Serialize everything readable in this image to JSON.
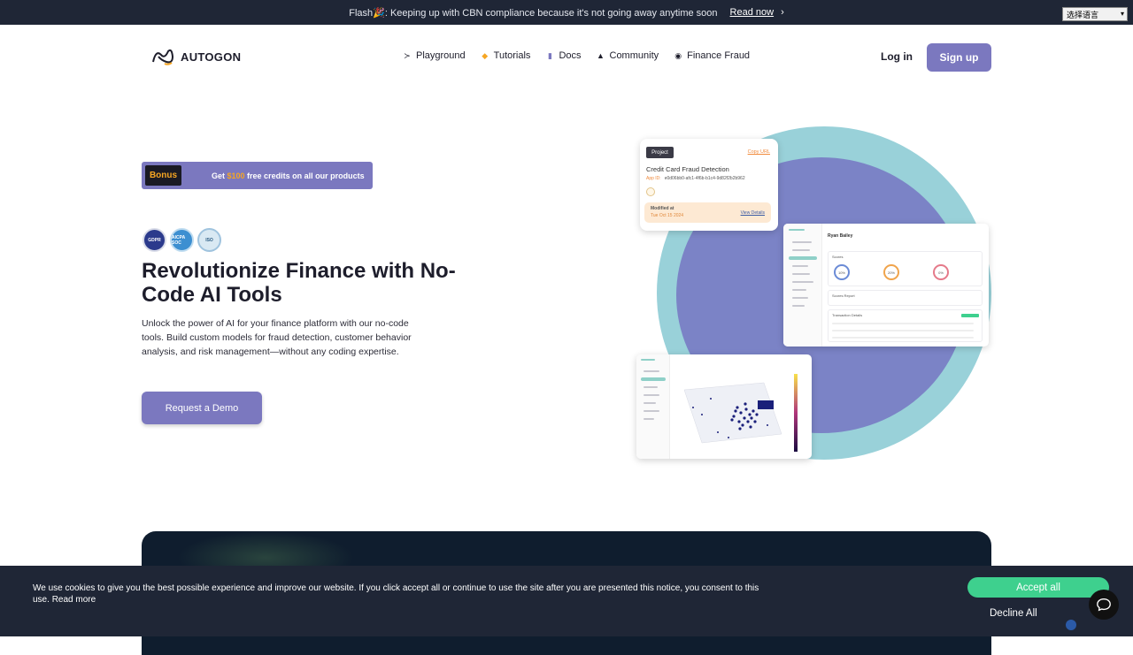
{
  "flash": {
    "message": "Flash🎉: Keeping up with CBN compliance because it's not going away anytime soon",
    "read_now": "Read now",
    "chevron": "›"
  },
  "language_select": {
    "value": "选择语言",
    "arrow": "▾"
  },
  "header": {
    "logo_text": "AUTOGON",
    "nav": [
      {
        "label": "Playground",
        "icon": "terminal-icon",
        "glyph": "≻"
      },
      {
        "label": "Tutorials",
        "icon": "tutorial-icon",
        "glyph": "◆"
      },
      {
        "label": "Docs",
        "icon": "document-icon",
        "glyph": "▮"
      },
      {
        "label": "Community",
        "icon": "community-icon",
        "glyph": "▲"
      },
      {
        "label": "Finance Fraud",
        "icon": "shield-icon",
        "glyph": "◉"
      }
    ],
    "login": "Log in",
    "signup": "Sign up"
  },
  "hero": {
    "bonus_tag": "Bonus",
    "bonus_text_prefix": "Get ",
    "bonus_amount": "$100",
    "bonus_text_suffix": " free credits on all our products",
    "badges": [
      "GDPR",
      "AICPA SOC",
      "ISO"
    ],
    "title": "Revolutionize Finance with No-Code AI Tools",
    "description": "Unlock the power of AI for your finance platform with our no-code tools. Build custom models for fraud detection, customer behavior analysis, and risk management—without any coding expertise.",
    "demo_button": "Request a Demo"
  },
  "illustration": {
    "project_tag": "Project",
    "copy_url": "Copy URL",
    "project_title": "Credit Card Fraud Detection",
    "app_id_label": "App ID:",
    "app_id": "e0d06bb0-afc1-4f6b-b1c4-9d82f2b2b962",
    "modified_label": "Modified at",
    "modified_date": "Tue Oct 15 2024",
    "view_details": "View Details",
    "dash_user": "Ryan Bailey",
    "gauges": [
      "10%",
      "20%",
      "0%"
    ],
    "section_scores": "Scores",
    "section_report": "Scores Report",
    "section_transactions": "Transaction Details"
  },
  "cookie": {
    "text": "We use cookies to give you the best possible experience and improve our website. If you click accept all or continue to use the site after you are presented this notice, you consent to this use.",
    "read_more": "Read more",
    "accept": "Accept all",
    "decline": "Decline All"
  },
  "colors": {
    "accent": "#7b78bf",
    "dark": "#1f2636",
    "accept_green": "#3ed08e",
    "teal_ring": "#99d1d9",
    "bonus_amount": "#f6a623"
  }
}
